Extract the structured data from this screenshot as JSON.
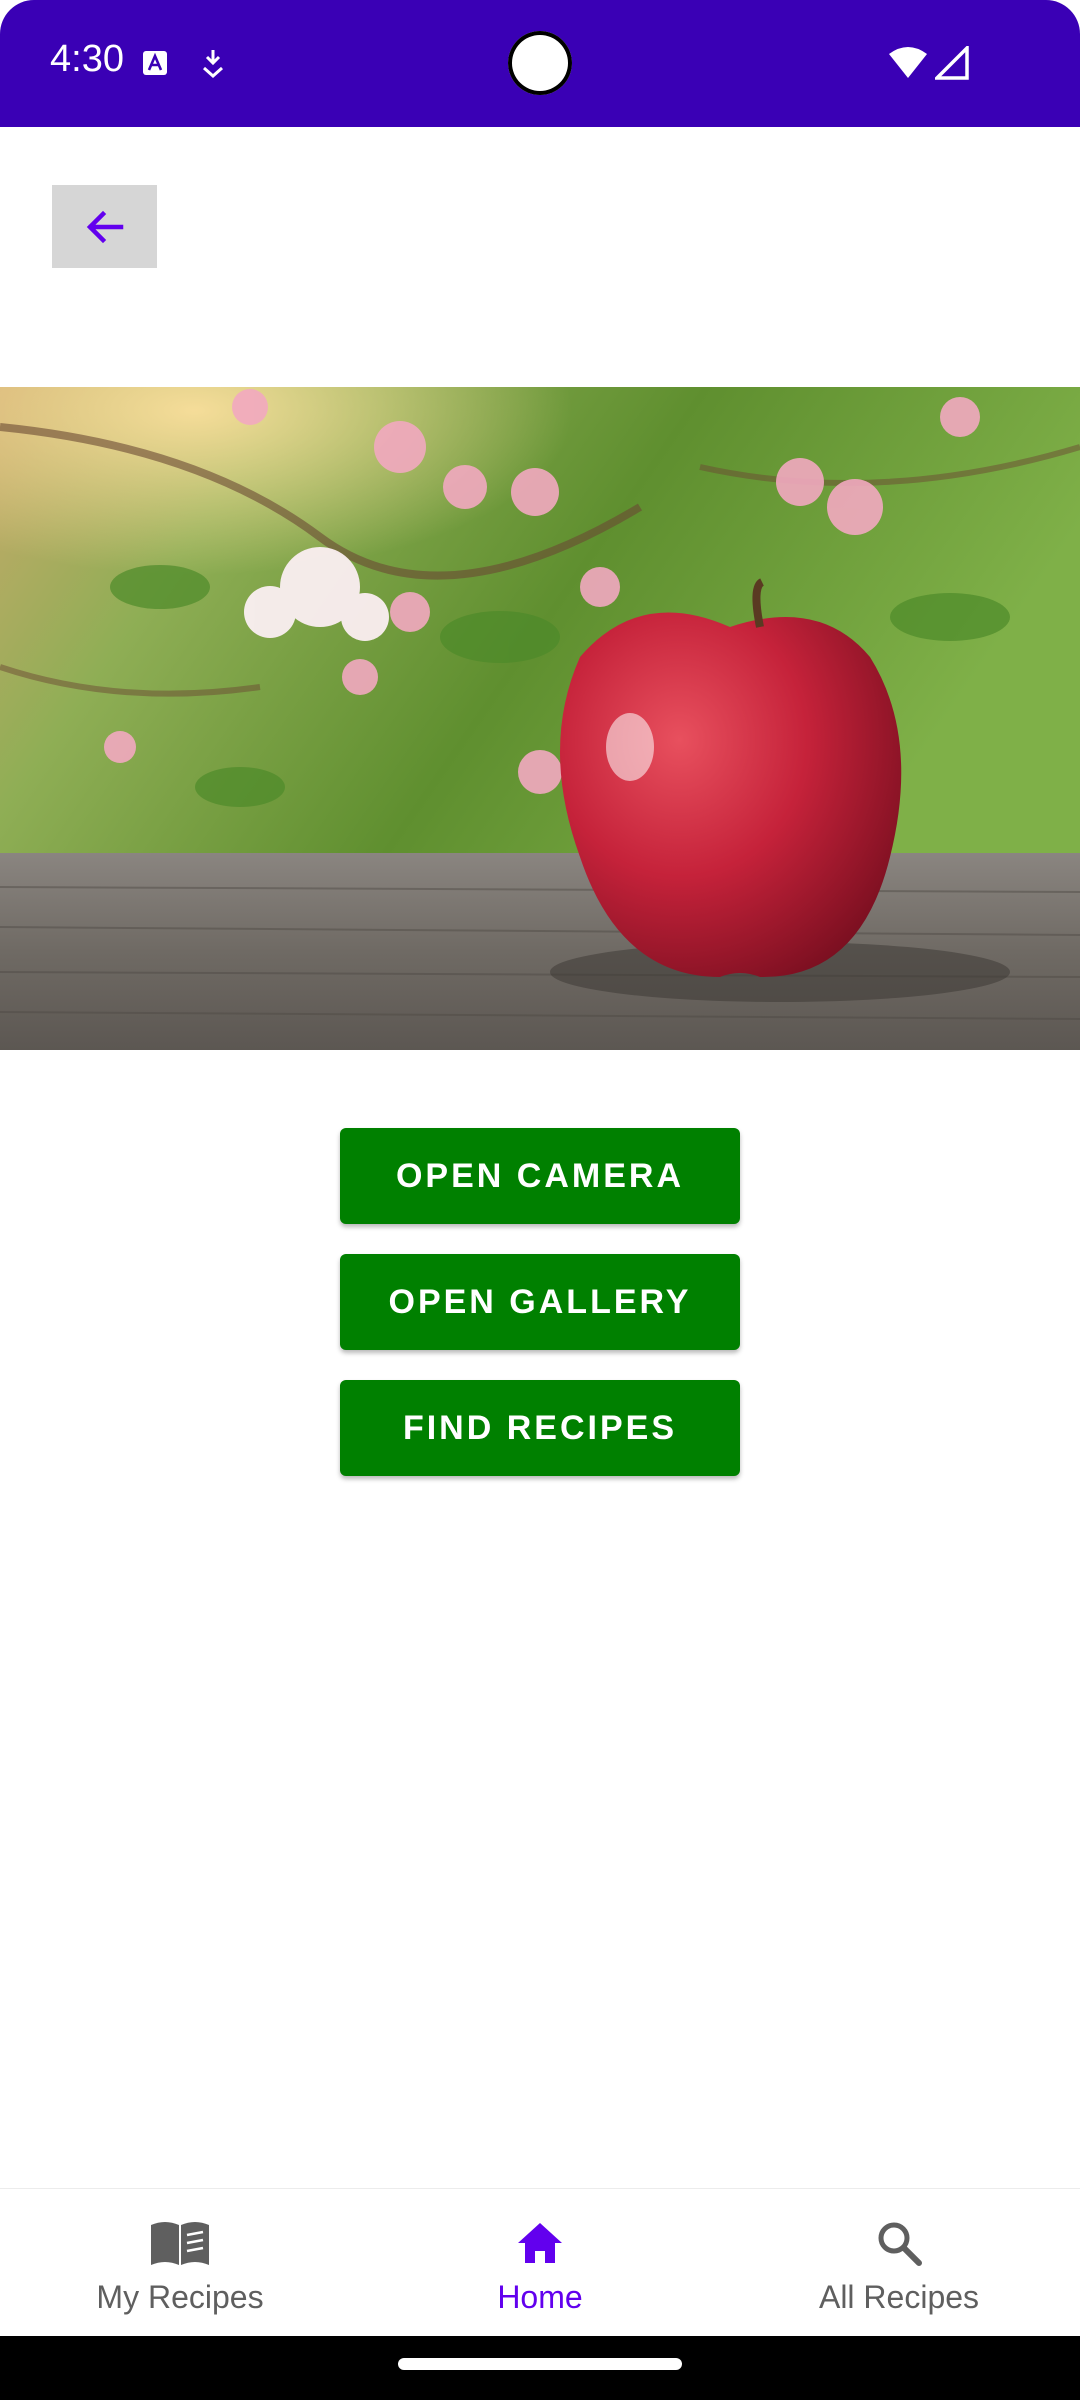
{
  "status_bar": {
    "time": "4:30",
    "icons": [
      "a-notification-icon",
      "download-icon",
      "wifi-icon",
      "cell-signal-icon"
    ]
  },
  "toolbar": {
    "back_icon": "arrow-back-icon"
  },
  "hero_image": {
    "subject": "red-apple-photo"
  },
  "actions": {
    "open_camera": "OPEN CAMERA",
    "open_gallery": "OPEN GALLERY",
    "find_recipes": "FIND RECIPES"
  },
  "bottom_nav": {
    "items": [
      {
        "label": "My Recipes",
        "icon": "book-icon",
        "active": false
      },
      {
        "label": "Home",
        "icon": "home-icon",
        "active": true
      },
      {
        "label": "All Recipes",
        "icon": "search-icon",
        "active": false
      }
    ]
  },
  "colors": {
    "status_bar": "#3a00b5",
    "accent": "#6200ee",
    "button": "#008000",
    "back_button_bg": "#d6d6d6"
  }
}
